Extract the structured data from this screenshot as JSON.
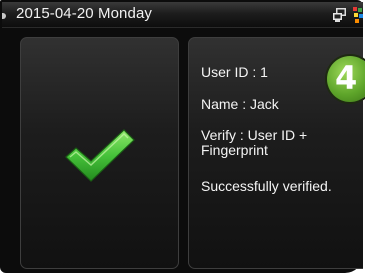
{
  "status_bar": {
    "date": "2015-04-20",
    "weekday": "Monday",
    "icons": [
      "network-icon",
      "color-palette-icon"
    ]
  },
  "result": {
    "icon": "checkmark-icon",
    "user_id": "User ID : 1",
    "name": "Name : Jack",
    "verify_line1": "Verify : User ID +",
    "verify_line2": "Fingerprint",
    "message": "Successfully verified.",
    "badge_number": "4"
  },
  "colors": {
    "check_green": "#4cc43a",
    "badge_green": "#5ea52a",
    "panel_bg": "#1d1d1d",
    "text": "#f4f4f4"
  }
}
